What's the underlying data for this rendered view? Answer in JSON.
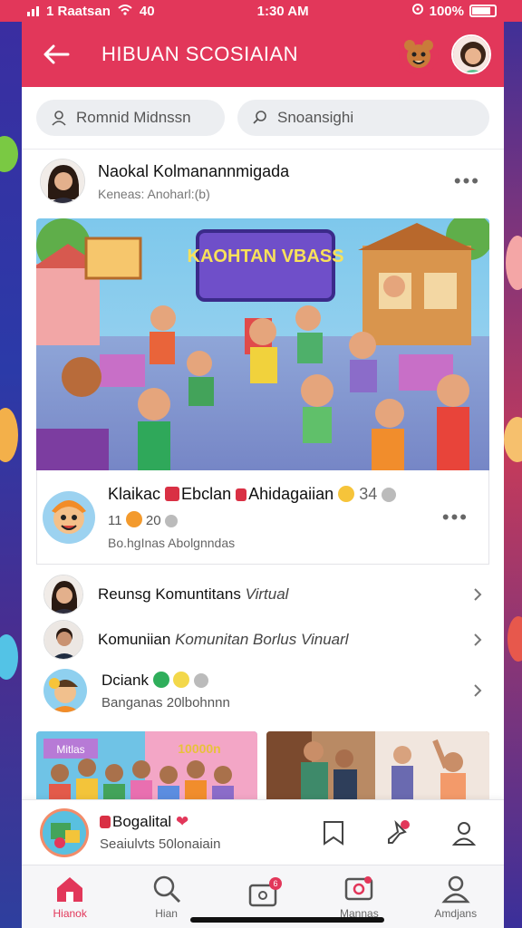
{
  "status": {
    "carrier": "1 Raatsan",
    "signal_extra": "40",
    "time": "1:30 AM",
    "battery": "100%"
  },
  "header": {
    "title": "HIBUAN SCOSIAIAN"
  },
  "search": {
    "left": "Romnid Midnssn",
    "right": "Snoansighi"
  },
  "post": {
    "name": "Naokal Kolmanannmigada",
    "sub": "Keneas: Anoharl:(b)"
  },
  "hero": {
    "sign": "KAOHTAN VBASS"
  },
  "group_card": {
    "name_a": "Klaikac",
    "name_b": "Ebclan",
    "name_c": "Ahidagaiian",
    "name_count": "34",
    "meta_a": "11",
    "meta_b": "20",
    "sub": "Bo.hgInas Abolgnndas"
  },
  "list": [
    {
      "title": "Reunsg Komuntitans",
      "title_italic": "Virtual"
    },
    {
      "title": "Komuniian",
      "title_italic": "Komunitan Borlus Vinuarl"
    },
    {
      "title": "Dciank",
      "sub": "Banganas 20lbohnnn"
    }
  ],
  "thumbs": {
    "left_label": "Mitlas",
    "left_label2": "10000n"
  },
  "mini_bar": {
    "name": "Bogalital",
    "sub": "Seaiulvts 50lonaiain"
  },
  "nav": [
    {
      "label": "Hianok",
      "icon": "home-icon"
    },
    {
      "label": "Hian",
      "icon": "search-icon"
    },
    {
      "label": "",
      "icon": "messages-icon"
    },
    {
      "label": "Mannas",
      "icon": "media-icon"
    },
    {
      "label": "Amdjans",
      "icon": "profile-icon"
    }
  ],
  "colors": {
    "accent": "#e2375a",
    "background": "#3a2f9a"
  }
}
